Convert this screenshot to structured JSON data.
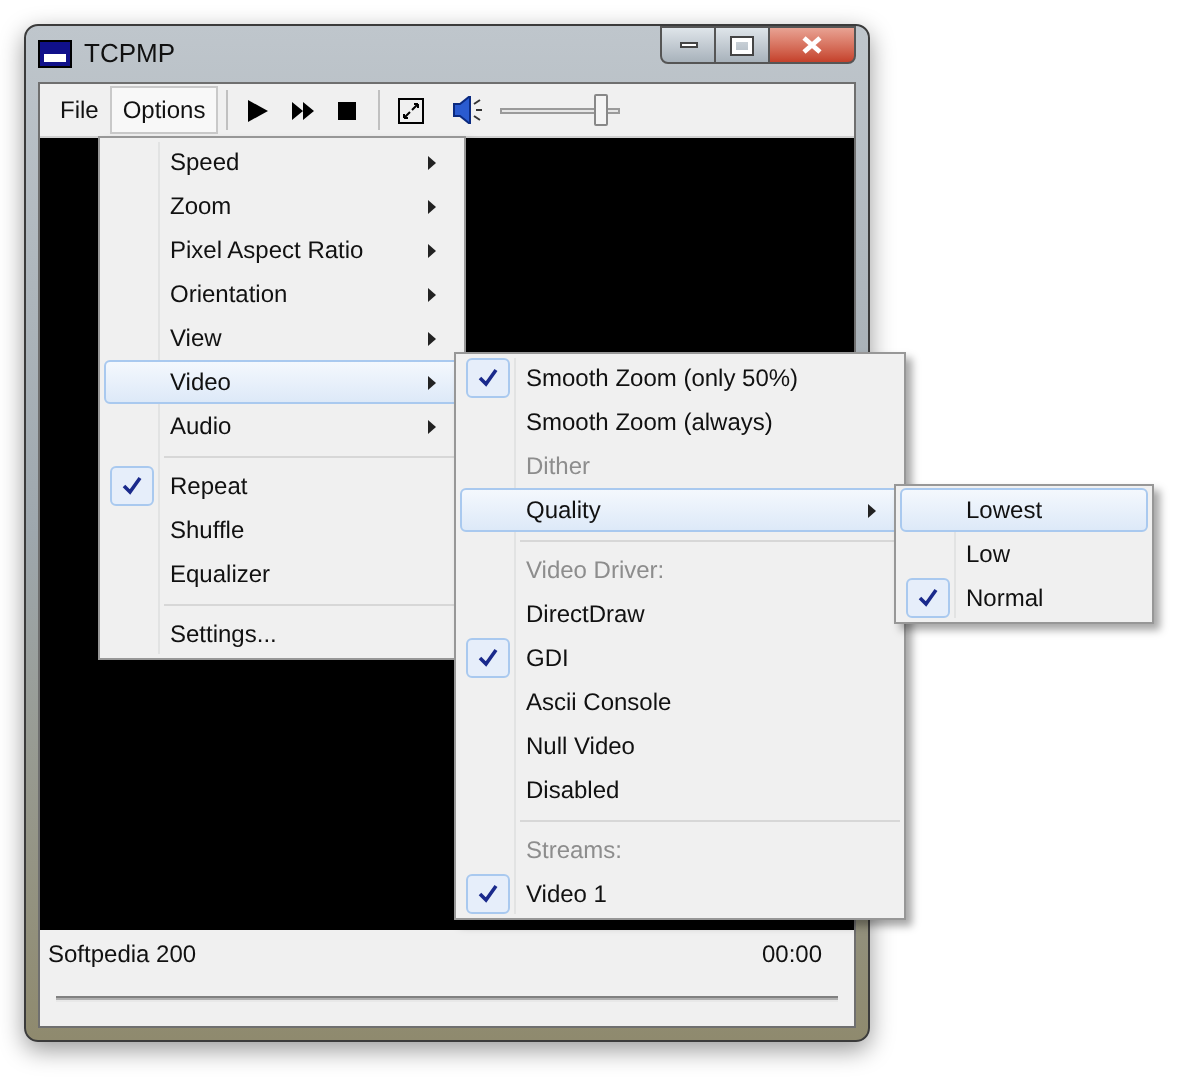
{
  "window": {
    "title": "TCPMP"
  },
  "menu_bar": [
    {
      "label": "File",
      "selected": false
    },
    {
      "label": "Options",
      "selected": true
    }
  ],
  "volume": {
    "level": 0.85
  },
  "status_bar": {
    "title": "Softpedia 200",
    "time": "00:00"
  },
  "options_menu": [
    {
      "kind": "item",
      "label": "Speed",
      "submenu": true,
      "checked": false,
      "selected": false
    },
    {
      "kind": "item",
      "label": "Zoom",
      "submenu": true,
      "checked": false,
      "selected": false
    },
    {
      "kind": "item",
      "label": "Pixel Aspect Ratio",
      "submenu": true,
      "checked": false,
      "selected": false
    },
    {
      "kind": "item",
      "label": "Orientation",
      "submenu": true,
      "checked": false,
      "selected": false
    },
    {
      "kind": "item",
      "label": "View",
      "submenu": true,
      "checked": false,
      "selected": false
    },
    {
      "kind": "item",
      "label": "Video",
      "submenu": true,
      "checked": false,
      "selected": true
    },
    {
      "kind": "item",
      "label": "Audio",
      "submenu": true,
      "checked": false,
      "selected": false
    },
    {
      "kind": "separator"
    },
    {
      "kind": "item",
      "label": "Repeat",
      "submenu": false,
      "checked": true,
      "selected": false
    },
    {
      "kind": "item",
      "label": "Shuffle",
      "submenu": false,
      "checked": false,
      "selected": false
    },
    {
      "kind": "item",
      "label": "Equalizer",
      "submenu": false,
      "checked": false,
      "selected": false
    },
    {
      "kind": "separator"
    },
    {
      "kind": "item",
      "label": "Settings...",
      "submenu": false,
      "checked": false,
      "selected": false
    }
  ],
  "video_menu": [
    {
      "kind": "item",
      "label": "Smooth Zoom (only 50%)",
      "submenu": false,
      "checked": true,
      "selected": false
    },
    {
      "kind": "item",
      "label": "Smooth Zoom (always)",
      "submenu": false,
      "checked": false,
      "selected": false
    },
    {
      "kind": "header",
      "label": "Dither"
    },
    {
      "kind": "item",
      "label": "Quality",
      "submenu": true,
      "checked": false,
      "selected": true
    },
    {
      "kind": "separator"
    },
    {
      "kind": "header",
      "label": "Video Driver:"
    },
    {
      "kind": "item",
      "label": "DirectDraw",
      "submenu": false,
      "checked": false,
      "selected": false
    },
    {
      "kind": "item",
      "label": "GDI",
      "submenu": false,
      "checked": true,
      "selected": false
    },
    {
      "kind": "item",
      "label": "Ascii Console",
      "submenu": false,
      "checked": false,
      "selected": false
    },
    {
      "kind": "item",
      "label": "Null Video",
      "submenu": false,
      "checked": false,
      "selected": false
    },
    {
      "kind": "item",
      "label": "Disabled",
      "submenu": false,
      "checked": false,
      "selected": false
    },
    {
      "kind": "separator"
    },
    {
      "kind": "header",
      "label": "Streams:"
    },
    {
      "kind": "item",
      "label": "Video 1",
      "submenu": false,
      "checked": true,
      "selected": false
    }
  ],
  "quality_menu": [
    {
      "kind": "item",
      "label": "Lowest",
      "submenu": false,
      "checked": false,
      "selected": true
    },
    {
      "kind": "item",
      "label": "Low",
      "submenu": false,
      "checked": false,
      "selected": false
    },
    {
      "kind": "item",
      "label": "Normal",
      "submenu": false,
      "checked": true,
      "selected": false
    }
  ]
}
